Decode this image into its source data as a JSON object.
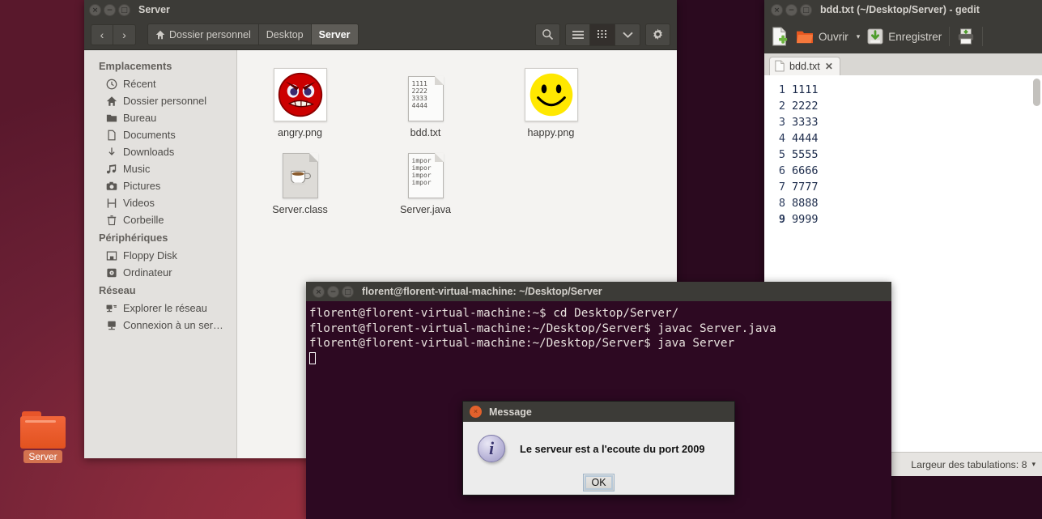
{
  "desktop": {
    "folder_icon": {
      "label": "Server",
      "icon": "folder-icon"
    }
  },
  "file_manager": {
    "window_title": "Server",
    "window_buttons": {
      "close": "×",
      "minimize": "−",
      "maximize": "□"
    },
    "nav": {
      "back": "‹",
      "forward": "›"
    },
    "breadcrumbs": [
      {
        "label": "Dossier personnel",
        "icon": "home-icon",
        "active": false
      },
      {
        "label": "Desktop",
        "icon": "",
        "active": false
      },
      {
        "label": "Server",
        "icon": "",
        "active": true
      }
    ],
    "toolbar_icons": [
      {
        "name": "search-icon",
        "active": false
      },
      {
        "name": "list-view-icon",
        "active": false
      },
      {
        "name": "grid-view-icon",
        "active": true
      },
      {
        "name": "chevron-down-icon",
        "active": false
      },
      {
        "name": "gear-icon",
        "active": false
      }
    ],
    "sidebar": {
      "sections": [
        {
          "heading": "Emplacements",
          "items": [
            {
              "label": "Récent",
              "icon": "clock-icon"
            },
            {
              "label": "Dossier personnel",
              "icon": "home-icon"
            },
            {
              "label": "Bureau",
              "icon": "folder-icon"
            },
            {
              "label": "Documents",
              "icon": "document-icon"
            },
            {
              "label": "Downloads",
              "icon": "download-icon"
            },
            {
              "label": "Music",
              "icon": "music-note-icon"
            },
            {
              "label": "Pictures",
              "icon": "camera-icon"
            },
            {
              "label": "Videos",
              "icon": "film-icon"
            },
            {
              "label": "Corbeille",
              "icon": "trash-icon"
            }
          ]
        },
        {
          "heading": "Périphériques",
          "items": [
            {
              "label": "Floppy Disk",
              "icon": "floppy-icon"
            },
            {
              "label": "Ordinateur",
              "icon": "computer-disk-icon"
            }
          ]
        },
        {
          "heading": "Réseau",
          "items": [
            {
              "label": "Explorer le réseau",
              "icon": "network-icon"
            },
            {
              "label": "Connexion à un ser…",
              "icon": "server-connect-icon"
            }
          ]
        }
      ]
    },
    "files": [
      {
        "name": "angry.png",
        "kind": "image-angry"
      },
      {
        "name": "bdd.txt",
        "kind": "text",
        "preview": [
          "1111",
          "2222",
          "3333",
          "4444"
        ]
      },
      {
        "name": "happy.png",
        "kind": "image-happy"
      },
      {
        "name": "Server.class",
        "kind": "class"
      },
      {
        "name": "Server.java",
        "kind": "text",
        "preview": [
          "impor",
          "impor",
          "impor",
          "impor"
        ]
      }
    ]
  },
  "gedit": {
    "window_title": "bdd.txt (~/Desktop/Server) - gedit",
    "window_buttons": {
      "close": "×",
      "minimize": "−",
      "maximize": "□"
    },
    "toolbar": {
      "new_label": "",
      "open_label": "Ouvrir",
      "open_chevron": "▾",
      "save_label": "Enregistrer",
      "print_label": ""
    },
    "tab": {
      "label": "bdd.txt",
      "close": "✕"
    },
    "lines": [
      {
        "num": "1",
        "text": "1111",
        "current": false
      },
      {
        "num": "2",
        "text": "2222",
        "current": false
      },
      {
        "num": "3",
        "text": "3333",
        "current": false
      },
      {
        "num": "4",
        "text": "4444",
        "current": false
      },
      {
        "num": "5",
        "text": "5555",
        "current": false
      },
      {
        "num": "6",
        "text": "6666",
        "current": false
      },
      {
        "num": "7",
        "text": "7777",
        "current": false
      },
      {
        "num": "8",
        "text": "8888",
        "current": false
      },
      {
        "num": "9",
        "text": "9999",
        "current": true
      }
    ],
    "status": {
      "tab_width_label": "Largeur des tabulations: 8",
      "chevron": "▾"
    }
  },
  "terminal": {
    "window_title": "florent@florent-virtual-machine: ~/Desktop/Server",
    "window_buttons": {
      "close": "×",
      "minimize": "−",
      "maximize": "□"
    },
    "lines": [
      "florent@florent-virtual-machine:~$ cd Desktop/Server/",
      "florent@florent-virtual-machine:~/Desktop/Server$ javac Server.java",
      "florent@florent-virtual-machine:~/Desktop/Server$ java Server"
    ]
  },
  "dialog": {
    "title": "Message",
    "close": "×",
    "icon": "info-icon",
    "message": "Le serveur est a l'ecoute du port 2009",
    "ok_label": "OK"
  },
  "colors": {
    "desktop": "#7b2438",
    "chrome": "#3c3b37",
    "terminal_bg": "#2d0922",
    "accent_orange": "#e2521f",
    "sidebar_bg": "#e3e1de"
  }
}
